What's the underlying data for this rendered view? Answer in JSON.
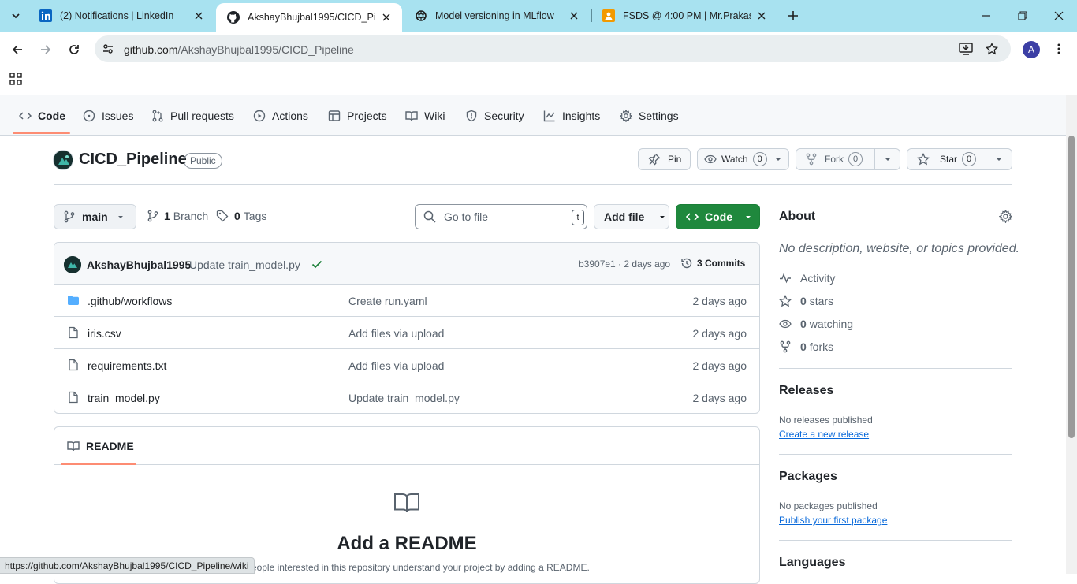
{
  "browser": {
    "tabs": [
      {
        "title": "(2) Notifications | LinkedIn",
        "icon": "linkedin-icon"
      },
      {
        "title": "AkshayBhujbal1995/CICD_Pipeline",
        "icon": "github-icon"
      },
      {
        "title": "Model versioning in MLflow",
        "icon": "openai-icon"
      },
      {
        "title": "FSDS @ 4:00 PM | Mr.Prakash Senapathi",
        "icon": "classroom-icon"
      }
    ],
    "url_host": "github.com",
    "url_path": "/AkshayBhujbal1995/CICD_Pipeline",
    "profile_initial": "A",
    "status_url": "https://github.com/AkshayBhujbal1995/CICD_Pipeline/wiki"
  },
  "repo_nav": [
    {
      "label": "Code",
      "icon": "code-icon"
    },
    {
      "label": "Issues",
      "icon": "issue-icon"
    },
    {
      "label": "Pull requests",
      "icon": "pull-request-icon"
    },
    {
      "label": "Actions",
      "icon": "play-icon"
    },
    {
      "label": "Projects",
      "icon": "table-icon"
    },
    {
      "label": "Wiki",
      "icon": "book-icon"
    },
    {
      "label": "Security",
      "icon": "shield-icon"
    },
    {
      "label": "Insights",
      "icon": "graph-icon"
    },
    {
      "label": "Settings",
      "icon": "gear-icon"
    }
  ],
  "repo": {
    "name": "CICD_Pipeline",
    "visibility": "Public",
    "pin_label": "Pin",
    "watch_label": "Watch",
    "watch_count": "0",
    "fork_label": "Fork",
    "fork_count": "0",
    "star_label": "Star",
    "star_count": "0"
  },
  "branch_bar": {
    "branch": "main",
    "branch_count": "1",
    "branch_word": "Branch",
    "tag_count": "0",
    "tag_word": "Tags",
    "goto_placeholder": "Go to file",
    "goto_kbd": "t",
    "add_file": "Add file",
    "code": "Code"
  },
  "latest_commit": {
    "author": "AkshayBhujbal1995",
    "message": "Update train_model.py",
    "hash_age": "b3907e1 · 2 days ago",
    "commits": "3 Commits"
  },
  "files": [
    {
      "name": ".github/workflows",
      "type": "folder",
      "commit": "Create run.yaml",
      "age": "2 days ago"
    },
    {
      "name": "iris.csv",
      "type": "file",
      "commit": "Add files via upload",
      "age": "2 days ago"
    },
    {
      "name": "requirements.txt",
      "type": "file",
      "commit": "Add files via upload",
      "age": "2 days ago"
    },
    {
      "name": "train_model.py",
      "type": "file",
      "commit": "Update train_model.py",
      "age": "2 days ago"
    }
  ],
  "readme": {
    "tab": "README",
    "title": "Add a README",
    "description": "Help people interested in this repository understand your project by adding a README."
  },
  "sidebar": {
    "about_title": "About",
    "about_desc": "No description, website, or topics provided.",
    "activity": "Activity",
    "stars_count": "0",
    "stars_word": "stars",
    "watching_count": "0",
    "watching_word": "watching",
    "forks_count": "0",
    "forks_word": "forks",
    "releases_title": "Releases",
    "releases_none": "No releases published",
    "releases_link": "Create a new release",
    "packages_title": "Packages",
    "packages_none": "No packages published",
    "packages_link": "Publish your first package",
    "languages_title": "Languages"
  },
  "colors": {
    "tabstrip": "#a8e2f0",
    "accent_underline": "#fd8c73",
    "code_button": "#1f883d",
    "link": "#0969da",
    "check": "#1a7f37",
    "folder": "#54aeff"
  }
}
